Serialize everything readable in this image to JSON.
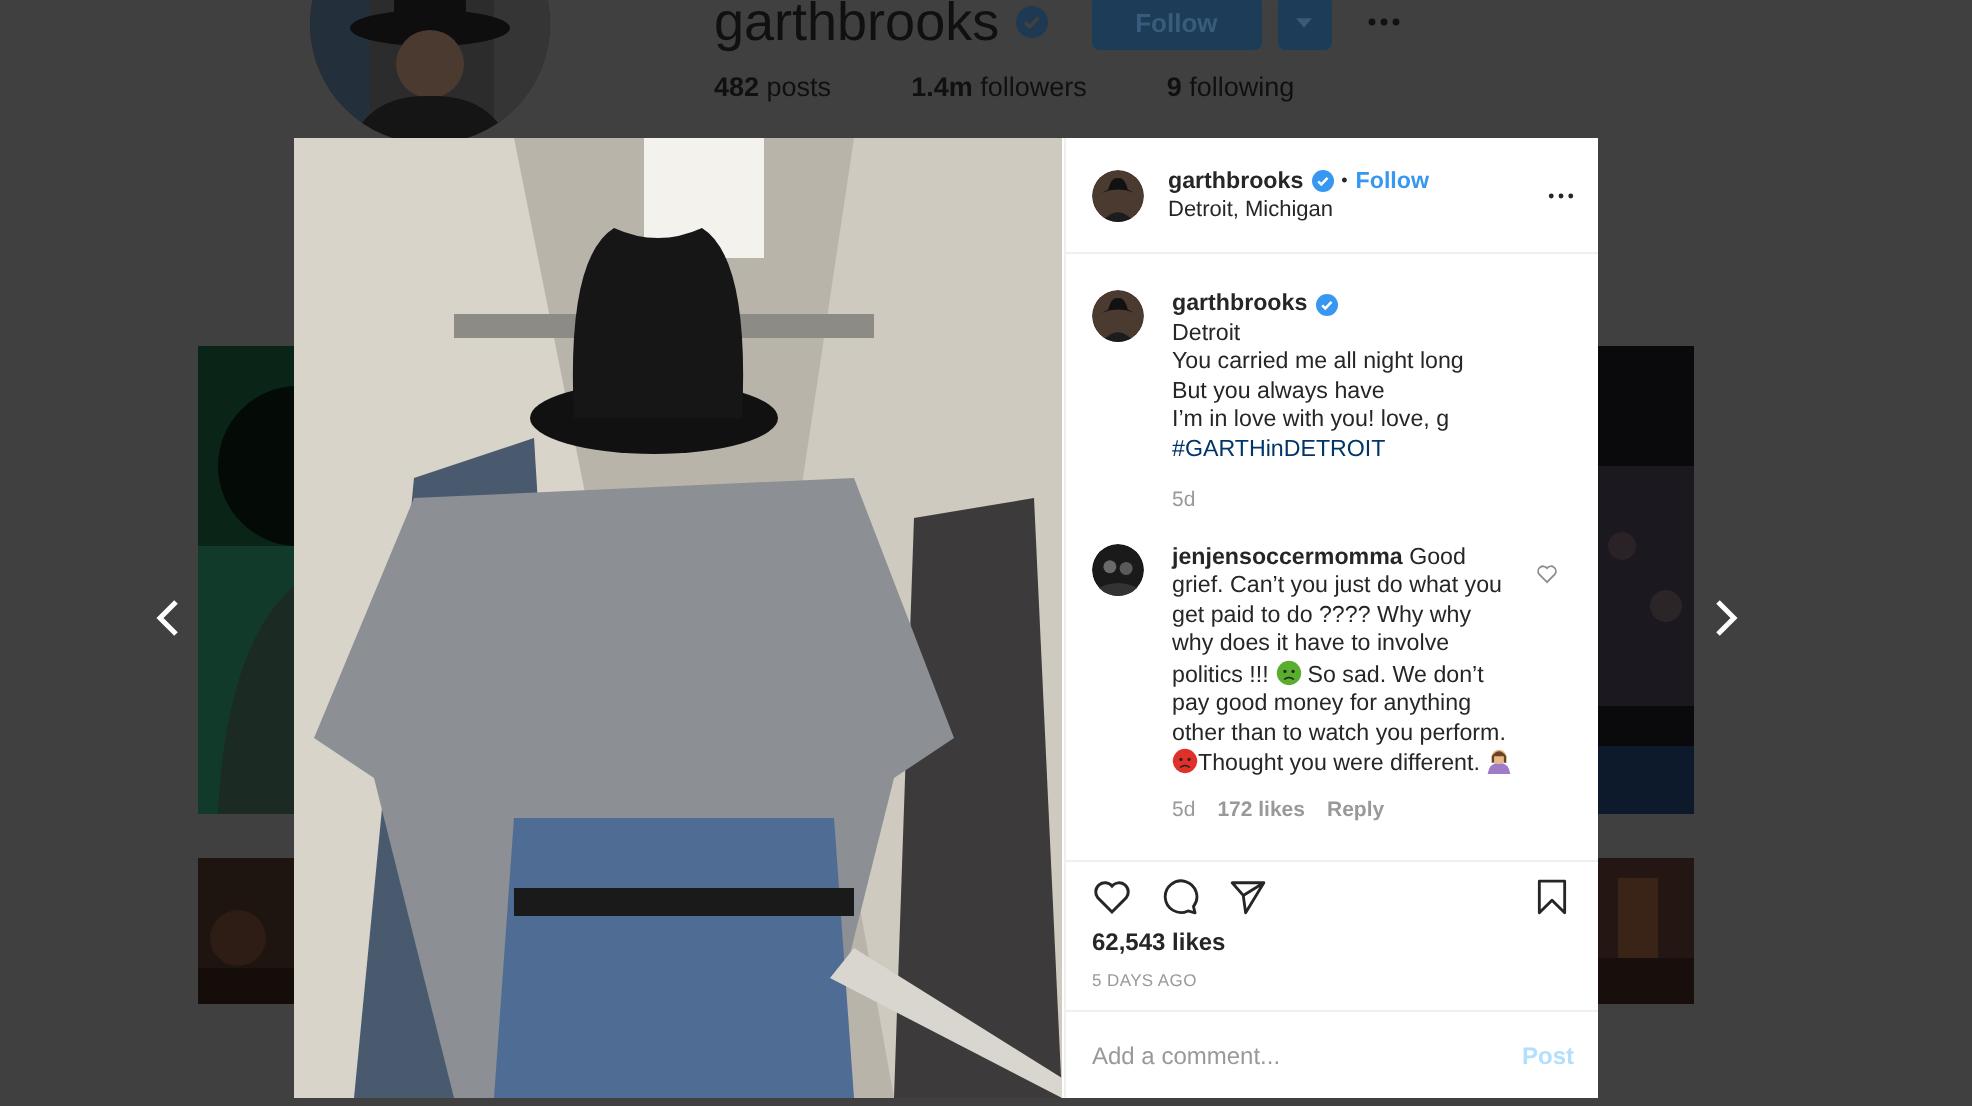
{
  "profile": {
    "username": "garthbrooks",
    "verified": true,
    "follow_button": "Follow",
    "stats": [
      {
        "count": "482",
        "label": "posts"
      },
      {
        "count": "1.4m",
        "label": "followers"
      },
      {
        "count": "9",
        "label": "following"
      }
    ]
  },
  "post": {
    "author": {
      "username": "garthbrooks",
      "verified": true,
      "separator": "•",
      "follow": "Follow",
      "location": "Detroit, Michigan"
    },
    "caption": {
      "username": "garthbrooks",
      "verified": true,
      "lines": [
        "Detroit",
        "You carried me all night long",
        "But you always have",
        "I’m in love with you! love, g"
      ],
      "hashtag": "#GARTHinDETROIT",
      "age": "5d"
    },
    "comments": [
      {
        "username": "jenjensoccermomma",
        "liked": false,
        "parts": [
          {
            "kind": "text",
            "text": "Good grief. Can’t you just do what you get paid to do ???? Why why why does it have to involve politics !!! "
          },
          {
            "kind": "face",
            "color": "#5aae2e"
          },
          {
            "kind": "text",
            "text": " So sad. We don’t pay good money for anything other than to watch you perform. "
          },
          {
            "kind": "face",
            "color": "#e0302a"
          },
          {
            "kind": "text",
            "text": "Thought you were different. "
          },
          {
            "kind": "person",
            "color": "#a07cc8"
          }
        ],
        "age": "5d",
        "likes": "172 likes",
        "reply": "Reply"
      }
    ],
    "likes": "62,543 likes",
    "date": "5 DAYS AGO",
    "saved": false,
    "comment_field": {
      "placeholder": "Add a comment...",
      "post_button": "Post"
    }
  }
}
